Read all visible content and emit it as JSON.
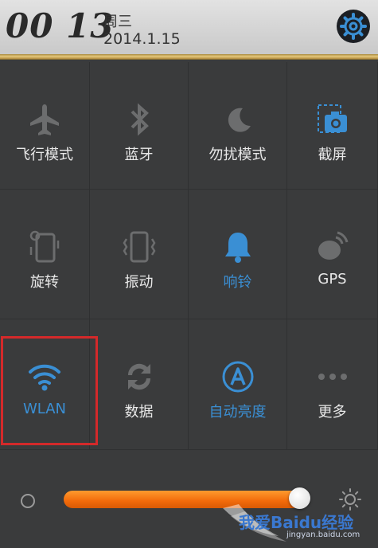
{
  "status": {
    "time": "00 13",
    "weekday": "周三",
    "date": "2014.1.15"
  },
  "toggles": [
    {
      "label": "飞行模式",
      "icon": "airplane-icon",
      "active": false
    },
    {
      "label": "蓝牙",
      "icon": "bluetooth-icon",
      "active": false
    },
    {
      "label": "勿扰模式",
      "icon": "moon-icon",
      "active": false
    },
    {
      "label": "截屏",
      "icon": "screenshot-icon",
      "active": false
    },
    {
      "label": "旋转",
      "icon": "rotate-icon",
      "active": false
    },
    {
      "label": "振动",
      "icon": "vibrate-icon",
      "active": false
    },
    {
      "label": "响铃",
      "icon": "bell-icon",
      "active": true
    },
    {
      "label": "GPS",
      "icon": "gps-icon",
      "active": false
    },
    {
      "label": "WLAN",
      "icon": "wifi-icon",
      "active": true
    },
    {
      "label": "数据",
      "icon": "data-icon",
      "active": false
    },
    {
      "label": "自动亮度",
      "icon": "auto-brightness-icon",
      "active": true
    },
    {
      "label": "更多",
      "icon": "more-icon",
      "active": false
    }
  ],
  "brightness": {
    "level": 0.97
  },
  "watermark": {
    "text": "我爱Baidu经验",
    "url": "jingyan.baidu.com"
  },
  "colors": {
    "active": "#3a8fd4",
    "slider": "#f26a0a",
    "highlight": "#d4292a"
  }
}
